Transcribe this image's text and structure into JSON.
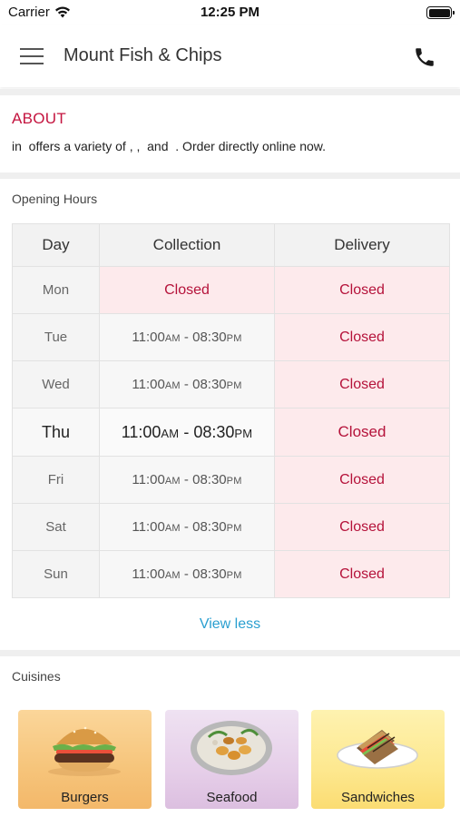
{
  "status_bar": {
    "carrier": "Carrier",
    "time": "12:25 PM"
  },
  "header": {
    "title": "Mount Fish & Chips"
  },
  "about": {
    "title": "ABOUT",
    "text": "in  offers a variety of , ,  and  . Order directly online now."
  },
  "opening_hours": {
    "heading": "Opening Hours",
    "columns": [
      "Day",
      "Collection",
      "Delivery"
    ],
    "rows": [
      {
        "day": "Mon",
        "collection": "Closed",
        "delivery": "Closed",
        "today": false
      },
      {
        "day": "Tue",
        "collection_open": "11:00",
        "collection_open_suffix": "AM",
        "collection_sep": " - ",
        "collection_close": "08:30",
        "collection_close_suffix": "PM",
        "delivery": "Closed",
        "today": false
      },
      {
        "day": "Wed",
        "collection_open": "11:00",
        "collection_open_suffix": "AM",
        "collection_sep": " - ",
        "collection_close": "08:30",
        "collection_close_suffix": "PM",
        "delivery": "Closed",
        "today": false
      },
      {
        "day": "Thu",
        "collection_open": "11:00",
        "collection_open_suffix": "AM",
        "collection_sep": " - ",
        "collection_close": "08:30",
        "collection_close_suffix": "PM",
        "delivery": "Closed",
        "today": true
      },
      {
        "day": "Fri",
        "collection_open": "11:00",
        "collection_open_suffix": "AM",
        "collection_sep": " - ",
        "collection_close": "08:30",
        "collection_close_suffix": "PM",
        "delivery": "Closed",
        "today": false
      },
      {
        "day": "Sat",
        "collection_open": "11:00",
        "collection_open_suffix": "AM",
        "collection_sep": " - ",
        "collection_close": "08:30",
        "collection_close_suffix": "PM",
        "delivery": "Closed",
        "today": false
      },
      {
        "day": "Sun",
        "collection_open": "11:00",
        "collection_open_suffix": "AM",
        "collection_sep": " - ",
        "collection_close": "08:30",
        "collection_close_suffix": "PM",
        "delivery": "Closed",
        "today": false
      }
    ],
    "toggle_label": "View less"
  },
  "cuisines": {
    "heading": "Cuisines",
    "items": [
      {
        "label": "Burgers",
        "icon": "burger-image"
      },
      {
        "label": "Seafood",
        "icon": "seafood-image"
      },
      {
        "label": "Sandwiches",
        "icon": "sandwich-image"
      }
    ]
  },
  "colors": {
    "accent_red": "#c4143f",
    "closed_text": "#b5123a",
    "closed_bg": "#fdeaec",
    "link_blue": "#2a9fd0"
  }
}
